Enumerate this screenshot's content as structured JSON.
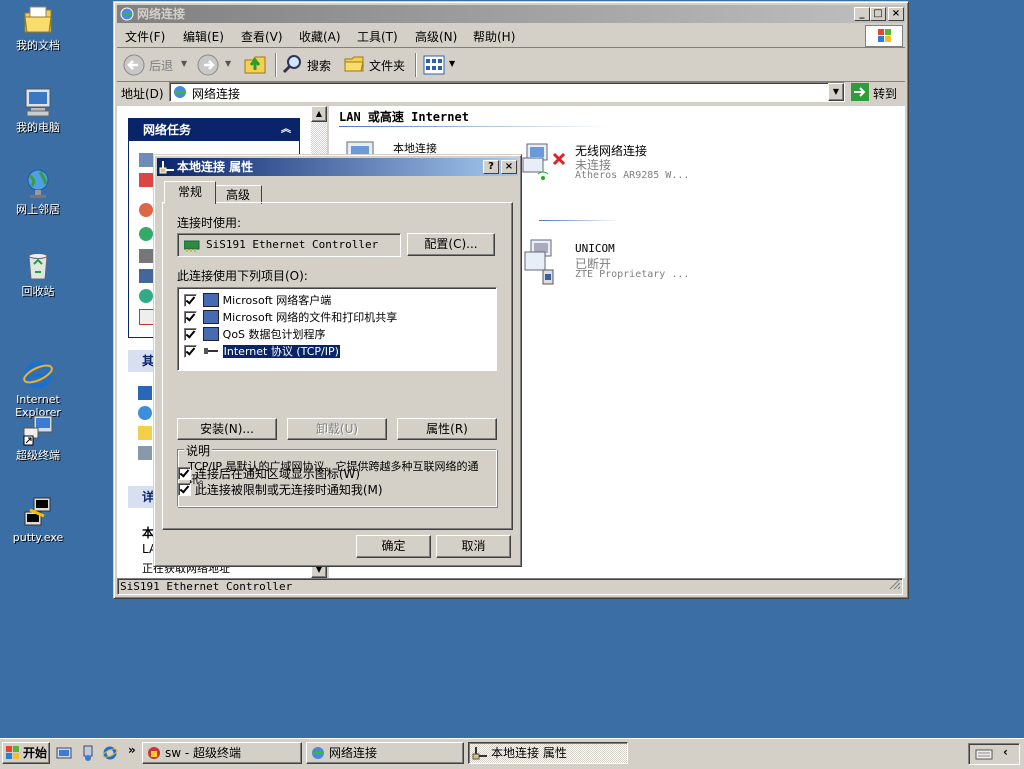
{
  "desktop": {
    "icons": [
      {
        "label": "我的文档",
        "icon": "my-documents-icon"
      },
      {
        "label": "我的电脑",
        "icon": "my-computer-icon"
      },
      {
        "label": "网上邻居",
        "icon": "network-places-icon"
      },
      {
        "label": "回收站",
        "icon": "recycle-bin-icon"
      },
      {
        "label": "Internet\nExplorer",
        "icon": "internet-explorer-icon"
      },
      {
        "label": "超级终端",
        "icon": "hyperterminal-icon"
      },
      {
        "label": "putty.exe",
        "icon": "putty-icon"
      }
    ]
  },
  "explorer": {
    "title": "网络连接",
    "menu": [
      "文件(F)",
      "编辑(E)",
      "查看(V)",
      "收藏(A)",
      "工具(T)",
      "高级(N)",
      "帮助(H)"
    ],
    "toolbar": {
      "back": "后退",
      "search": "搜索",
      "folders": "文件夹"
    },
    "address_label": "地址(D)",
    "address_value": "网络连接",
    "go_label": "转到",
    "tasks_header": "网络任务",
    "other_header": "其",
    "details_header": "详",
    "details_lines": [
      "本",
      "LA",
      "正在获取网络地址"
    ],
    "group_header": "LAN 或高速 Internet",
    "connections": [
      {
        "name": "本地连接",
        "status": "",
        "device": ""
      },
      {
        "name": "无线网络连接",
        "status": "未连接",
        "device": "Atheros AR9285 W..."
      },
      {
        "name": "UNICOM",
        "status": "已断开",
        "device": "ZTE Proprietary ..."
      }
    ],
    "statusbar": "SiS191 Ethernet Controller"
  },
  "dialog": {
    "title": "本地连接 属性",
    "tabs": [
      "常规",
      "高级"
    ],
    "connect_using_label": "连接时使用:",
    "adapter_name": "SiS191 Ethernet Controller",
    "configure_button": "配置(C)...",
    "items_label": "此连接使用下列项目(O):",
    "items": [
      {
        "label": "Microsoft 网络客户端",
        "checked": true
      },
      {
        "label": "Microsoft 网络的文件和打印机共享",
        "checked": true
      },
      {
        "label": "QoS 数据包计划程序",
        "checked": true
      },
      {
        "label": "Internet 协议 (TCP/IP)",
        "checked": true,
        "selected": true
      }
    ],
    "install_button": "安装(N)...",
    "uninstall_button": "卸载(U)",
    "properties_button": "属性(R)",
    "description_legend": "说明",
    "description_text": "TCP/IP 是默认的广域网协议。它提供跨越多种互联网络的通讯。",
    "show_icon_label": "连接后在通知区域显示图标(W)",
    "notify_label": "此连接被限制或无连接时通知我(M)",
    "ok_button": "确定",
    "cancel_button": "取消"
  },
  "taskbar": {
    "start": "开始",
    "chevron": "»",
    "tasks": [
      {
        "label": "sw - 超级终端"
      },
      {
        "label": "网络连接"
      },
      {
        "label": "本地连接 属性"
      }
    ],
    "tray_chevron": "‹"
  },
  "colors": {
    "desktop": "#3a6ea5",
    "titlebar_active": "#0a246a",
    "selection": "#0a246a",
    "face": "#d4d0c8"
  }
}
